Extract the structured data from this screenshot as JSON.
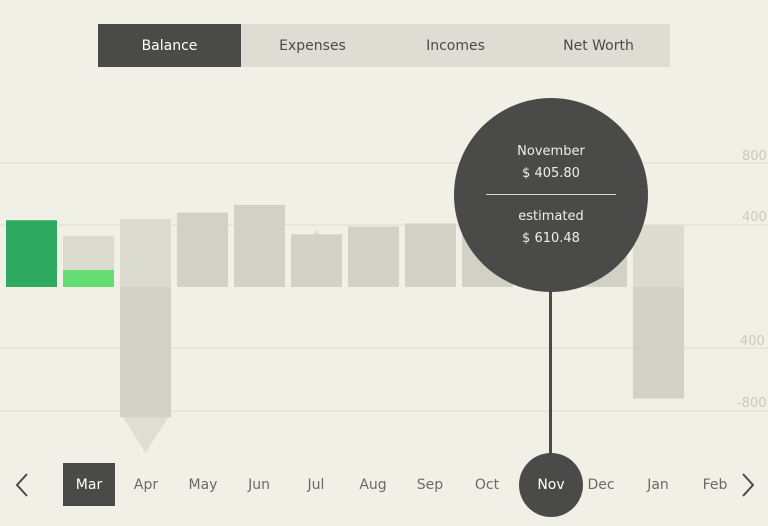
{
  "tabs": [
    {
      "label": "Balance",
      "active": true
    },
    {
      "label": "Expenses",
      "active": false
    },
    {
      "label": "Incomes",
      "active": false
    },
    {
      "label": "Net Worth",
      "active": false
    }
  ],
  "tooltip": {
    "month": "November",
    "actual": "$ 405.80",
    "estimated_label": "estimated",
    "estimated": "$ 610.48"
  },
  "months": [
    "Mar",
    "Apr",
    "May",
    "Jun",
    "Jul",
    "Aug",
    "Sep",
    "Oct",
    "Nov",
    "Dec",
    "Jan",
    "Feb"
  ],
  "selected_month": "Mar",
  "current_month": "Nov",
  "colors": {
    "background": "#f1f0e6",
    "dark": "#4a4a48",
    "bar_gray": "#dcdbd0",
    "bar_dark_gray": "#d2d1c6",
    "green_dark": "#2daa5f",
    "green_light": "#66dd72"
  },
  "chart_data": {
    "type": "bar",
    "y_ticks": [
      "800",
      "400",
      "400",
      "-800"
    ],
    "ylim": [
      -1000,
      1000
    ],
    "series": [
      {
        "values": [
          430,
          330,
          440,
          270,
          300,
          300,
          250,
          350,
          400,
          240,
          280,
          400
        ]
      },
      {
        "values": [
          430,
          110,
          -840,
          480,
          530,
          340,
          390,
          410,
          405.8,
          370,
          620,
          -720
        ]
      }
    ],
    "estimated": [
      null,
      330,
      -1070,
      410,
      440,
      370,
      390,
      null,
      610.48,
      370,
      1040,
      400
    ]
  }
}
